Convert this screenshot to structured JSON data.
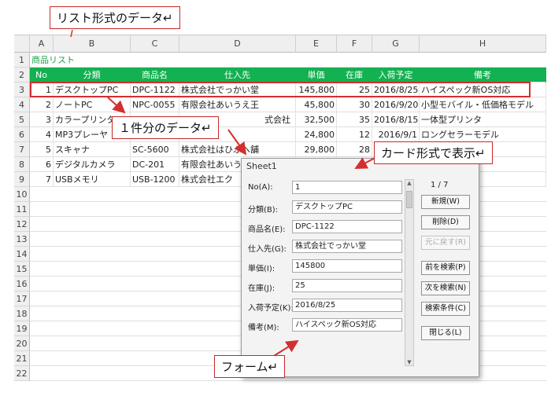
{
  "callouts": {
    "list_format": "リスト形式のデータ↵",
    "one_record": "１件分のデータ↵",
    "card_format": "カード形式で表示↵",
    "form": "フォーム↵"
  },
  "sheet": {
    "columns": [
      "A",
      "B",
      "C",
      "D",
      "E",
      "F",
      "G",
      "H"
    ],
    "row_numbers": [
      "1",
      "2",
      "3",
      "4",
      "5",
      "6",
      "7",
      "8",
      "9",
      "10",
      "11",
      "12",
      "13",
      "14",
      "15",
      "16",
      "17",
      "18",
      "19",
      "20",
      "21",
      "22"
    ],
    "title": "商品リスト",
    "headers": [
      "No",
      "分類",
      "商品名",
      "仕入先",
      "単価",
      "在庫",
      "入荷予定",
      "備考"
    ],
    "records": [
      [
        "1",
        "デスクトップPC",
        "DPC-1122",
        "株式会社でっかい堂",
        "145,800",
        "25",
        "2016/8/25",
        "ハイスペック新OS対応"
      ],
      [
        "2",
        "ノートPC",
        "NPC-0055",
        "有限会社あいうえ王",
        "45,800",
        "30",
        "2016/9/20",
        "小型モバイル・低価格モデル"
      ],
      [
        "3",
        "カラープリンタ",
        "",
        "式会社",
        "32,500",
        "35",
        "2016/8/15",
        "一体型プリンタ"
      ],
      [
        "4",
        "MP3プレーヤ",
        "",
        "",
        "24,800",
        "12",
        "2016/9/1",
        "ロングセラーモデル"
      ],
      [
        "5",
        "スキャナ",
        "SC-5600",
        "株式会社はひふへ舗",
        "29,800",
        "28",
        "",
        ""
      ],
      [
        "6",
        "デジタルカメラ",
        "DC-201",
        "有限会社あいう",
        "",
        "",
        "",
        ""
      ],
      [
        "7",
        "USBメモリ",
        "USB-1200",
        "株式会社エク",
        "",
        "",
        "",
        ""
      ]
    ]
  },
  "form": {
    "title": "Sheet1",
    "counter": "1 / 7",
    "fields": [
      {
        "label": "No(A):",
        "value": "1"
      },
      {
        "label": "分類(B):",
        "value": "デスクトップPC"
      },
      {
        "label": "商品名(E):",
        "value": "DPC-1122"
      },
      {
        "label": "仕入先(G):",
        "value": "株式会社でっかい堂"
      },
      {
        "label": "単価(I):",
        "value": "145800"
      },
      {
        "label": "在庫(J):",
        "value": "25"
      },
      {
        "label": "入荷予定(K):",
        "value": "2016/8/25"
      },
      {
        "label": "備考(M):",
        "value": "ハイスペック新OS対応"
      }
    ],
    "buttons": {
      "new": "新規(W)",
      "delete": "削除(D)",
      "restore": "元に戻す(R)",
      "find_prev": "前を検索(P)",
      "find_next": "次を検索(N)",
      "criteria": "検索条件(C)",
      "close": "閉じる(L)"
    }
  },
  "colors": {
    "header_green": "#13b151",
    "title_green": "#1aa34a",
    "callout_red": "#c62828"
  }
}
